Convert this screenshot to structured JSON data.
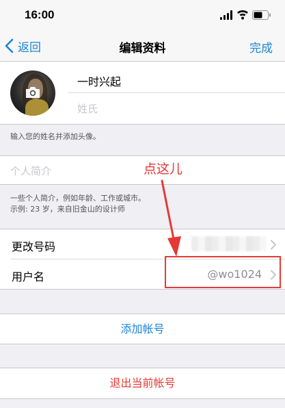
{
  "status_bar": {
    "time": "16:00"
  },
  "nav": {
    "back_label": "返回",
    "title": "编辑资料",
    "done_label": "完成"
  },
  "profile": {
    "first_name": "一时兴起",
    "last_name_placeholder": "姓氏"
  },
  "hints": {
    "name_hint": "输入您的姓名并添加头像。",
    "bio_hint_line1": "一些个人简介，例如年龄、工作或城市。",
    "bio_hint_line2": "示例: 23 岁，来自旧金山的设计师"
  },
  "bio": {
    "placeholder": "个人简介"
  },
  "settings": {
    "phone_label": "更改号码",
    "username_label": "用户名",
    "username_value": "@wo1024"
  },
  "actions": {
    "add_account": "添加帐号",
    "logout": "退出当前帐号"
  },
  "annotation": {
    "text": "点这儿"
  },
  "colors": {
    "accent": "#1a84d8",
    "danger": "#e53935",
    "background": "#efeff4"
  }
}
